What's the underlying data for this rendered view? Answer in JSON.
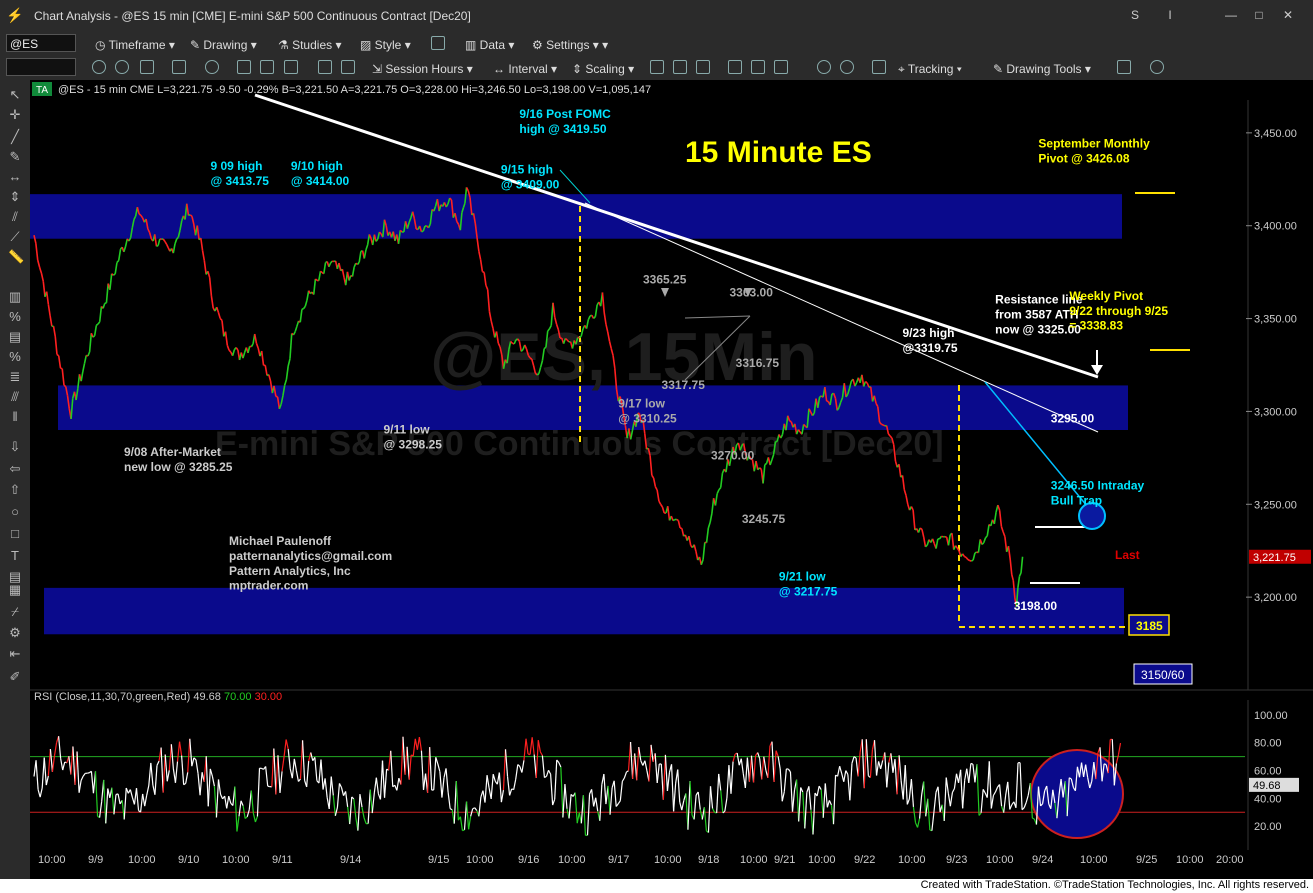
{
  "window": {
    "title": "Chart Analysis - @ES 15 min [CME] E-mini S&P 500 Continuous Contract [Dec20]"
  },
  "toolbar1": {
    "symbol": "@ES",
    "timeframe": "Timeframe",
    "drawing": "Drawing",
    "studies": "Studies",
    "style": "Style",
    "data": "Data",
    "settings": "Settings"
  },
  "toolbar2": {
    "session_hours": "Session Hours",
    "interval": "Interval",
    "scaling": "Scaling",
    "tracking": "Tracking",
    "drawing_tools": "Drawing Tools"
  },
  "header": {
    "ta": "TA",
    "info": "@ES - 15 min  CME  L=3,221.75  -9.50  -0.29%  B=3,221.50  A=3,221.75  O=3,228.00  Hi=3,246.50  Lo=3,198.00  V=1,095,147"
  },
  "watermark": {
    "big": "@ES, 15Min",
    "small": "E-mini S&P 500 Continuous Contract [Dec20]"
  },
  "footer": {
    "text": "Created with TradeStation. ©TradeStation Technologies, Inc. All rights reserved."
  },
  "chart_data": [
    {
      "type": "line",
      "title": "15 Minute ES",
      "ylim": [
        3150,
        3470
      ],
      "y_ticks": [
        "3,450.00",
        "3,400.00",
        "3,350.00",
        "3,300.00",
        "3,250.00",
        "3,200.00"
      ],
      "x_ticks": [
        "10:00",
        "9/9",
        "10:00",
        "9/10",
        "10:00",
        "9/11",
        "9/14",
        "9/15",
        "10:00",
        "9/16",
        "10:00",
        "9/17",
        "10:00",
        "9/18",
        "10:00",
        "9/21",
        "10:00",
        "9/22",
        "10:00",
        "9/23",
        "10:00",
        "9/24",
        "10:00",
        "9/25",
        "10:00",
        "20:00"
      ],
      "last_price": "3,221.75",
      "last_label": "Last",
      "price_path": [
        [
          0,
          3395
        ],
        [
          3,
          3370
        ],
        [
          8,
          3330
        ],
        [
          12,
          3300
        ],
        [
          18,
          3335
        ],
        [
          24,
          3365
        ],
        [
          28,
          3385
        ],
        [
          34,
          3408
        ],
        [
          38,
          3395
        ],
        [
          44,
          3385
        ],
        [
          50,
          3410
        ],
        [
          54,
          3390
        ],
        [
          58,
          3360
        ],
        [
          62,
          3340
        ],
        [
          66,
          3330
        ],
        [
          72,
          3340
        ],
        [
          76,
          3320
        ],
        [
          80,
          3300
        ],
        [
          84,
          3345
        ],
        [
          90,
          3365
        ],
        [
          96,
          3380
        ],
        [
          102,
          3370
        ],
        [
          108,
          3390
        ],
        [
          114,
          3400
        ],
        [
          118,
          3392
        ],
        [
          122,
          3405
        ],
        [
          126,
          3398
        ],
        [
          130,
          3410
        ],
        [
          134,
          3415
        ],
        [
          138,
          3400
        ],
        [
          140,
          3419.5
        ],
        [
          144,
          3390
        ],
        [
          148,
          3350
        ],
        [
          152,
          3325
        ],
        [
          156,
          3340
        ],
        [
          160,
          3330
        ],
        [
          164,
          3320
        ],
        [
          168,
          3355
        ],
        [
          172,
          3335
        ],
        [
          176,
          3340
        ],
        [
          180,
          3350
        ],
        [
          184,
          3363
        ],
        [
          188,
          3320
        ],
        [
          192,
          3285
        ],
        [
          196,
          3300
        ],
        [
          200,
          3270
        ],
        [
          204,
          3245
        ],
        [
          208,
          3245
        ],
        [
          212,
          3230
        ],
        [
          216,
          3217.75
        ],
        [
          220,
          3250
        ],
        [
          224,
          3270
        ],
        [
          228,
          3285
        ],
        [
          232,
          3275
        ],
        [
          236,
          3265
        ],
        [
          240,
          3280
        ],
        [
          244,
          3295
        ],
        [
          248,
          3290
        ],
        [
          252,
          3300
        ],
        [
          256,
          3310
        ],
        [
          260,
          3305
        ],
        [
          264,
          3315
        ],
        [
          268,
          3319.75
        ],
        [
          272,
          3305
        ],
        [
          276,
          3290
        ],
        [
          280,
          3270
        ],
        [
          284,
          3245
        ],
        [
          288,
          3230
        ],
        [
          292,
          3228
        ],
        [
          296,
          3232
        ],
        [
          300,
          3225
        ],
        [
          304,
          3222
        ],
        [
          308,
          3235
        ],
        [
          312,
          3246.5
        ],
        [
          316,
          3220
        ],
        [
          318,
          3198
        ],
        [
          320,
          3221.75
        ]
      ],
      "resistance_bands": [
        {
          "y_low": 3393,
          "y_high": 3417
        },
        {
          "y_low": 3290,
          "y_high": 3314
        },
        {
          "y_low": 3180,
          "y_high": 3205
        }
      ],
      "annotations": [
        {
          "text": "9 09 high",
          "x": 28,
          "y": 3430,
          "color": "#00e5ff"
        },
        {
          "text": "@ 3413.75",
          "x": 28,
          "y": 3422,
          "color": "#00e5ff"
        },
        {
          "text": "9/10 high",
          "x": 54,
          "y": 3430,
          "color": "#00e5ff"
        },
        {
          "text": "@ 3414.00",
          "x": 54,
          "y": 3422,
          "color": "#00e5ff"
        },
        {
          "text": "9/15 high",
          "x": 122,
          "y": 3428,
          "color": "#00e5ff"
        },
        {
          "text": "@ 3409.00",
          "x": 122,
          "y": 3420,
          "color": "#00e5ff"
        },
        {
          "text": "9/16 Post FOMC",
          "x": 128,
          "y": 3458,
          "color": "#00e5ff"
        },
        {
          "text": "high @ 3419.50",
          "x": 128,
          "y": 3450,
          "color": "#00e5ff"
        },
        {
          "text": "9/08 After-Market",
          "x": 0,
          "y": 3276,
          "color": "#cccccc"
        },
        {
          "text": "new low @ 3285.25",
          "x": 0,
          "y": 3268,
          "color": "#cccccc"
        },
        {
          "text": "9/11 low",
          "x": 84,
          "y": 3288,
          "color": "#cccccc"
        },
        {
          "text": "@ 3298.25",
          "x": 84,
          "y": 3280,
          "color": "#cccccc"
        },
        {
          "text": "3365.25",
          "x": 168,
          "y": 3369,
          "color": "#aaaaaa"
        },
        {
          "text": "3363.00",
          "x": 196,
          "y": 3362,
          "color": "#aaaaaa"
        },
        {
          "text": "3317.75",
          "x": 174,
          "y": 3312,
          "color": "#aaaaaa"
        },
        {
          "text": "9/17 low",
          "x": 160,
          "y": 3302,
          "color": "#aaaaaa"
        },
        {
          "text": "@ 3310.25",
          "x": 160,
          "y": 3294,
          "color": "#aaaaaa"
        },
        {
          "text": "3316.75",
          "x": 198,
          "y": 3324,
          "color": "#aaaaaa"
        },
        {
          "text": "3270.00",
          "x": 190,
          "y": 3274,
          "color": "#aaaaaa"
        },
        {
          "text": "3245.75",
          "x": 200,
          "y": 3240,
          "color": "#aaaaaa"
        },
        {
          "text": "9/21 low",
          "x": 212,
          "y": 3209,
          "color": "#00e5ff"
        },
        {
          "text": "@ 3217.75",
          "x": 212,
          "y": 3201,
          "color": "#00e5ff"
        },
        {
          "text": "9/23 high",
          "x": 252,
          "y": 3340,
          "color": "#ffffff"
        },
        {
          "text": "@3319.75",
          "x": 252,
          "y": 3332,
          "color": "#ffffff"
        },
        {
          "text": "Resistance line",
          "x": 282,
          "y": 3358,
          "color": "#ffffff"
        },
        {
          "text": "from 3587 ATH",
          "x": 282,
          "y": 3350,
          "color": "#ffffff"
        },
        {
          "text": "now @ 3325.00",
          "x": 282,
          "y": 3342,
          "color": "#ffffff"
        },
        {
          "text": "3295.00",
          "x": 300,
          "y": 3294,
          "color": "#ffffff"
        },
        {
          "text": "3246.50 Intraday",
          "x": 300,
          "y": 3258,
          "color": "#00e5ff"
        },
        {
          "text": "Bull Trap",
          "x": 300,
          "y": 3250,
          "color": "#00e5ff"
        },
        {
          "text": "3198.00",
          "x": 288,
          "y": 3193,
          "color": "#ffffff"
        },
        {
          "text": "September Monthly",
          "x": 296,
          "y": 3442,
          "color": "#ffff00"
        },
        {
          "text": "Pivot @ 3426.08",
          "x": 296,
          "y": 3434,
          "color": "#ffff00"
        },
        {
          "text": "Weekly Pivot",
          "x": 306,
          "y": 3360,
          "color": "#ffff00"
        },
        {
          "text": "9/22 through 9/25",
          "x": 306,
          "y": 3352,
          "color": "#ffff00"
        },
        {
          "text": "= 3338.83",
          "x": 306,
          "y": 3344,
          "color": "#ffff00"
        },
        {
          "text": "Michael Paulenoff",
          "x": 34,
          "y": 3228,
          "color": "#cccccc"
        },
        {
          "text": "patternanalytics@gmail.com",
          "x": 34,
          "y": 3220,
          "color": "#cccccc"
        },
        {
          "text": "Pattern Analytics, Inc",
          "x": 34,
          "y": 3212,
          "color": "#cccccc"
        },
        {
          "text": "mptrader.com",
          "x": 34,
          "y": 3204,
          "color": "#cccccc"
        }
      ],
      "boxed_labels": [
        {
          "text": "3185",
          "color": "#ffff00"
        },
        {
          "text": "3150/60",
          "color": "#ffffff"
        }
      ]
    },
    {
      "type": "line",
      "title": "RSI (Close,11,30,70,green,Red)",
      "values_text": {
        "rsi": "49.68",
        "ob": "70.00",
        "os": "30.00"
      },
      "y_ticks": [
        "100.00",
        "80.00",
        "60.00",
        "40.00",
        "20.00"
      ],
      "ylim": [
        10,
        105
      ],
      "last_value": "49.68"
    }
  ]
}
